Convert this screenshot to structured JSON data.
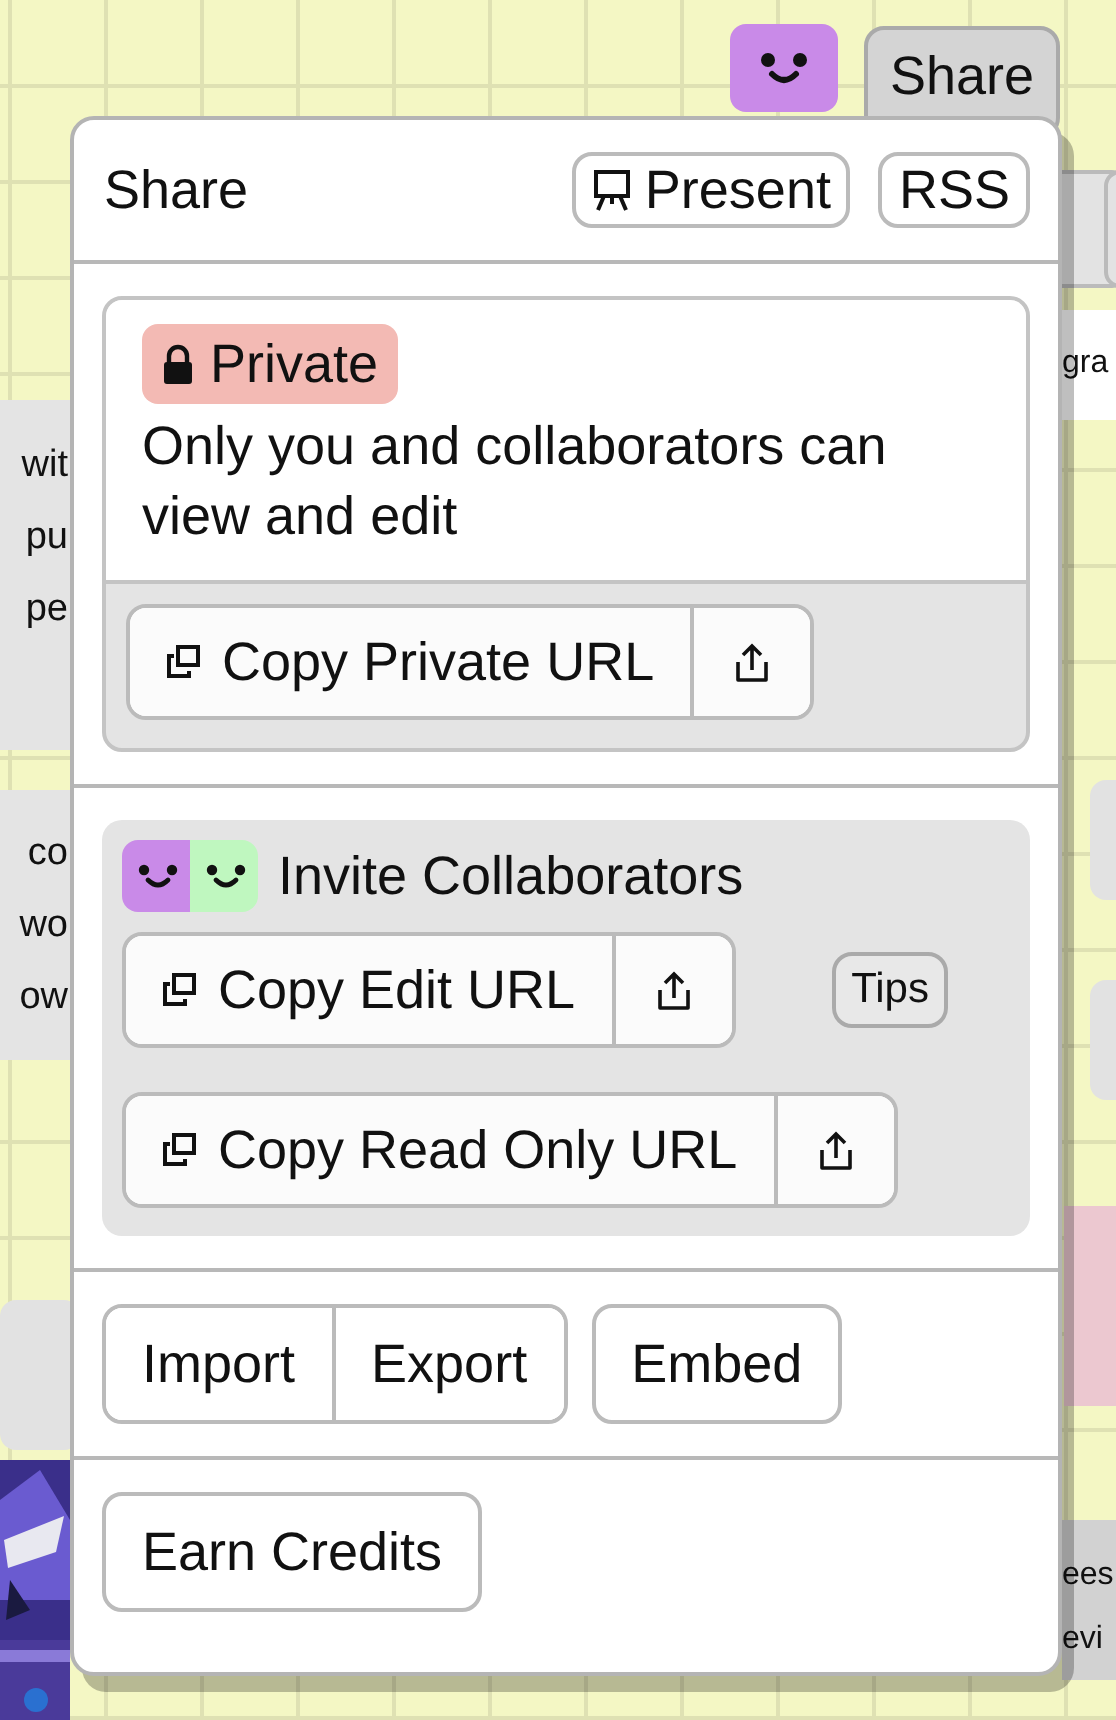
{
  "toolbar": {
    "share_button": "Share"
  },
  "background": {
    "left_cards": [
      {
        "lines": [
          "wit",
          "pu",
          "pe"
        ]
      },
      {
        "lines": [
          "co",
          "wo",
          "ow"
        ]
      }
    ],
    "right_cards": [
      {
        "lines": [
          "gra"
        ]
      },
      {
        "lines": [
          "ees",
          "evi"
        ]
      }
    ]
  },
  "share_panel": {
    "title": "Share",
    "header_buttons": [
      {
        "kind": "present",
        "label": "Present"
      },
      {
        "kind": "plain",
        "label": "RSS"
      }
    ],
    "privacy": {
      "badge": "Private",
      "description": "Only you and collaborators can view and edit",
      "copy_button": "Copy Private URL"
    },
    "invite": {
      "title": "Invite Collaborators",
      "links": [
        {
          "label": "Copy Edit URL"
        },
        {
          "label": "Copy Read Only URL"
        }
      ],
      "tips": "Tips"
    },
    "file_buttons": [
      "Import",
      "Export"
    ],
    "embed_button": "Embed",
    "earn_credits_button": "Earn Credits"
  }
}
